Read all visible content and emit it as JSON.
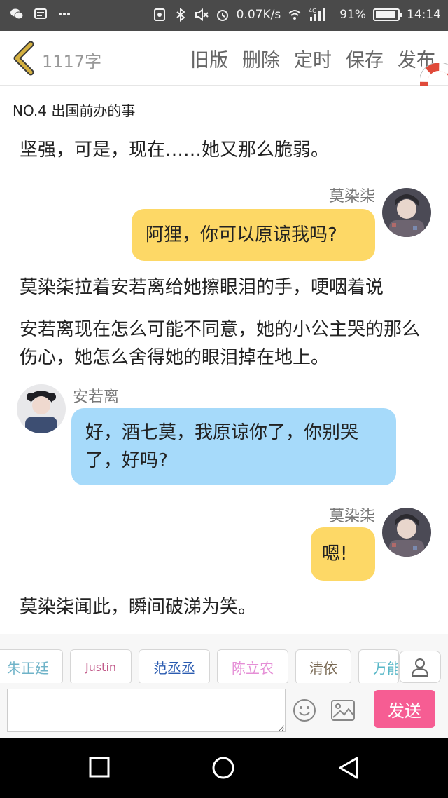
{
  "status_bar": {
    "speed": "0.07K/s",
    "network": "4G",
    "battery_text": "91%",
    "battery_level": 0.91,
    "time": "14:14",
    "icons": [
      "wechat-icon",
      "message-icon",
      "more-icon",
      "screenshot-icon",
      "bluetooth-icon",
      "mute-icon",
      "alarm-icon",
      "wifi-icon",
      "signal-icon",
      "battery-icon"
    ]
  },
  "toolbar": {
    "word_count": "1117字",
    "actions": [
      "旧版",
      "删除",
      "定时",
      "保存",
      "发布"
    ]
  },
  "chapter": {
    "title": "NO.4  出国前办的事"
  },
  "messages": {
    "p1": "坚强，可是，现在……她又那么脆弱。",
    "m1_name": "莫染柒",
    "m1_text": "阿狸，你可以原谅我吗?",
    "p2": "莫染柒拉着安若离给她擦眼泪的手，哽咽着说",
    "p3": "安若离现在怎么可能不同意，她的小公主哭的那么伤心，她怎么舍得她的眼泪掉在地上。",
    "m2_name": "安若离",
    "m2_text": "好，酒七莫，我原谅你了，你别哭了，好吗?",
    "m3_name": "莫染柒",
    "m3_text": "嗯!",
    "p4": "莫染柒闻此，瞬间破涕为笑。"
  },
  "characters": [
    {
      "label": "朱正廷",
      "color": "#6fb3c8"
    },
    {
      "label": "Justin",
      "color": "#c25a8a"
    },
    {
      "label": "范丞丞",
      "color": "#2a5bb0"
    },
    {
      "label": "陈立农",
      "color": "#e58fd6"
    },
    {
      "label": "清依",
      "color": "#7a6a55"
    },
    {
      "label": "万能",
      "color": "#58b7c7"
    }
  ],
  "composer": {
    "placeholder": "",
    "send_label": "发送"
  },
  "colors": {
    "accent_yellow": "#fdd866",
    "accent_blue": "#a6dafa",
    "send_pink": "#f65d93",
    "back_arrow": "#d4b040"
  }
}
